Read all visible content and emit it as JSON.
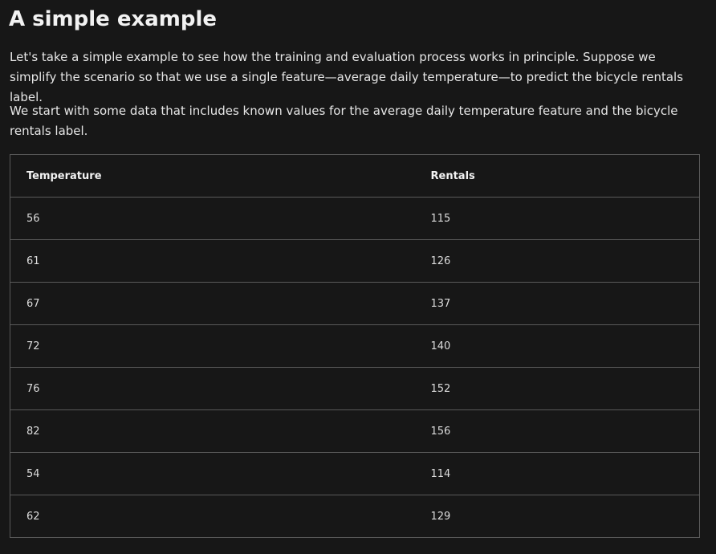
{
  "heading": "A simple example",
  "paragraphs": [
    "Let's take a simple example to see how the training and evaluation process works in principle. Suppose we simplify the scenario so that we use a single feature—average daily temperature—to predict the bicycle rentals label.",
    "We start with some data that includes known values for the average daily temperature feature and the bicycle rentals label."
  ],
  "table": {
    "headers": [
      "Temperature",
      "Rentals"
    ],
    "rows": [
      [
        "56",
        "115"
      ],
      [
        "61",
        "126"
      ],
      [
        "67",
        "137"
      ],
      [
        "72",
        "140"
      ],
      [
        "76",
        "152"
      ],
      [
        "82",
        "156"
      ],
      [
        "54",
        "114"
      ],
      [
        "62",
        "129"
      ]
    ]
  },
  "colors": {
    "background": "#171717",
    "text": "#e6e6e6",
    "border": "#5a5a5a"
  }
}
